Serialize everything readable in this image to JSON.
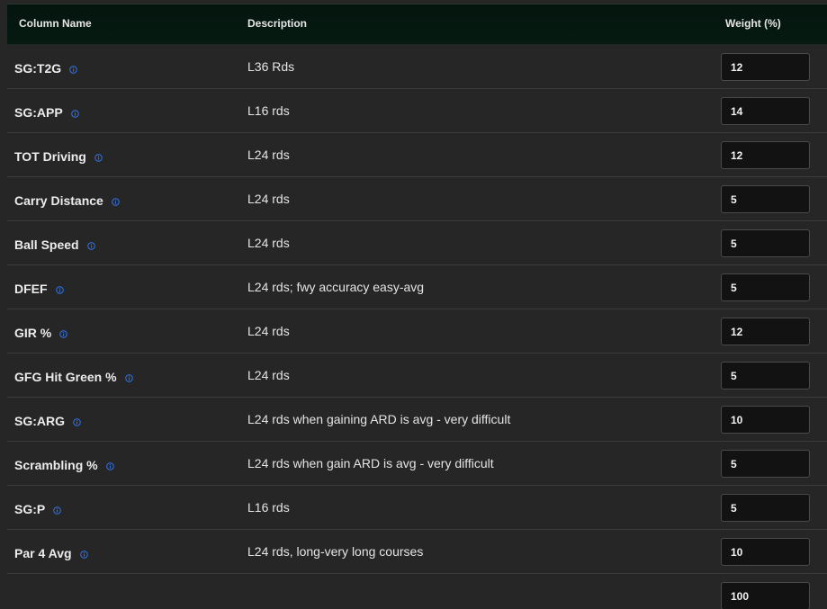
{
  "header": {
    "column_name": "Column Name",
    "description": "Description",
    "weight": "Weight (%)"
  },
  "colors": {
    "header_bg": "#04150e",
    "row_bg": "#262626",
    "info_icon": "#2f6fe0",
    "input_bg": "#121212"
  },
  "rows": [
    {
      "name": "SG:T2G",
      "description": "L36 Rds",
      "weight": "12"
    },
    {
      "name": "SG:APP",
      "description": "L16 rds",
      "weight": "14"
    },
    {
      "name": "TOT Driving",
      "description": "L24 rds",
      "weight": "12"
    },
    {
      "name": "Carry Distance",
      "description": "L24 rds",
      "weight": "5"
    },
    {
      "name": "Ball Speed",
      "description": "L24 rds",
      "weight": "5"
    },
    {
      "name": "DFEF",
      "description": "L24 rds; fwy accuracy easy-avg",
      "weight": "5"
    },
    {
      "name": "GIR %",
      "description": "L24 rds",
      "weight": "12"
    },
    {
      "name": "GFG Hit Green %",
      "description": "L24 rds",
      "weight": "5"
    },
    {
      "name": "SG:ARG",
      "description": "L24 rds when gaining ARD is avg - very difficult",
      "weight": "10"
    },
    {
      "name": "Scrambling %",
      "description": "L24 rds when gain ARD is avg - very difficult",
      "weight": "5"
    },
    {
      "name": "SG:P",
      "description": "L16 rds",
      "weight": "5"
    },
    {
      "name": "Par 4 Avg",
      "description": "L24 rds, long-very long courses",
      "weight": "10"
    }
  ],
  "total": {
    "weight": "100"
  }
}
